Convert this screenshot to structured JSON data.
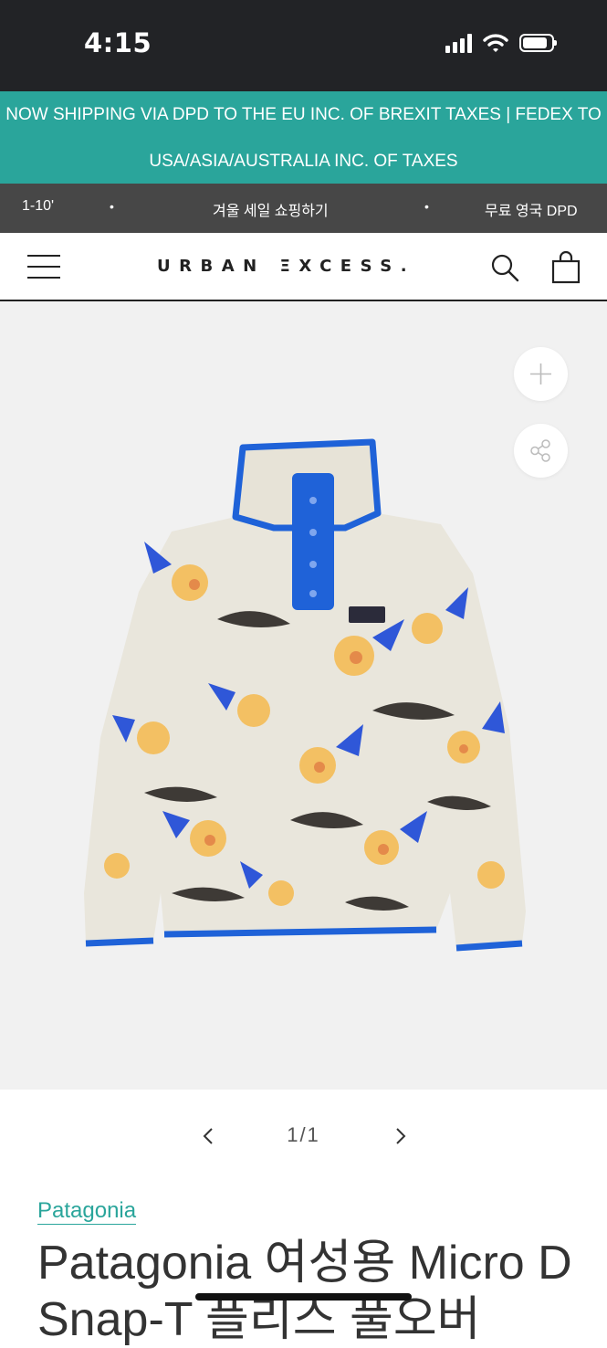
{
  "status_bar": {
    "time": "4:15"
  },
  "promo_banner": {
    "line1": "NOW SHIPPING VIA DPD TO THE EU INC. OF BREXIT TAXES | FEDEX TO",
    "line2": "USA/ASIA/AUSTRALIA INC. OF TAXES"
  },
  "info_strip": {
    "left": "1-10'",
    "dot": "•",
    "center": "겨울 세일 쇼핑하기",
    "right": "무료 영국 DPD"
  },
  "header": {
    "logo": "URBAN ΞXCESS."
  },
  "gallery": {
    "counter": "1/1"
  },
  "product": {
    "brand": "Patagonia",
    "title": "Patagonia 여성용 Micro D Snap-T 플리스 풀오버"
  },
  "colors": {
    "accent": "#2aa59b",
    "status_bar": "#222326",
    "info_strip": "#474747"
  }
}
